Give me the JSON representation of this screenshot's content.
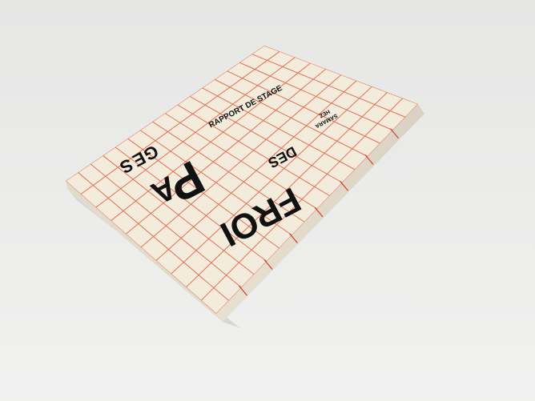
{
  "scene": {
    "description_free": true,
    "background_color": "#e9e9e8",
    "cover_color": "#f3ecdd",
    "grid_color": "#e05a3a",
    "ink_color": "#111111"
  },
  "cover": {
    "title": "RAPPORT DE STAGE",
    "word_pages": "PAGES",
    "word_pages_top": "S",
    "word_pages_mid": "E",
    "word_pages_g": "G",
    "word_pages_a": "A",
    "word_pages_p": "P",
    "word_des": "DES",
    "word_froi": "FROI",
    "author_line1": "SAMARA",
    "author_line2": "HEZ"
  }
}
